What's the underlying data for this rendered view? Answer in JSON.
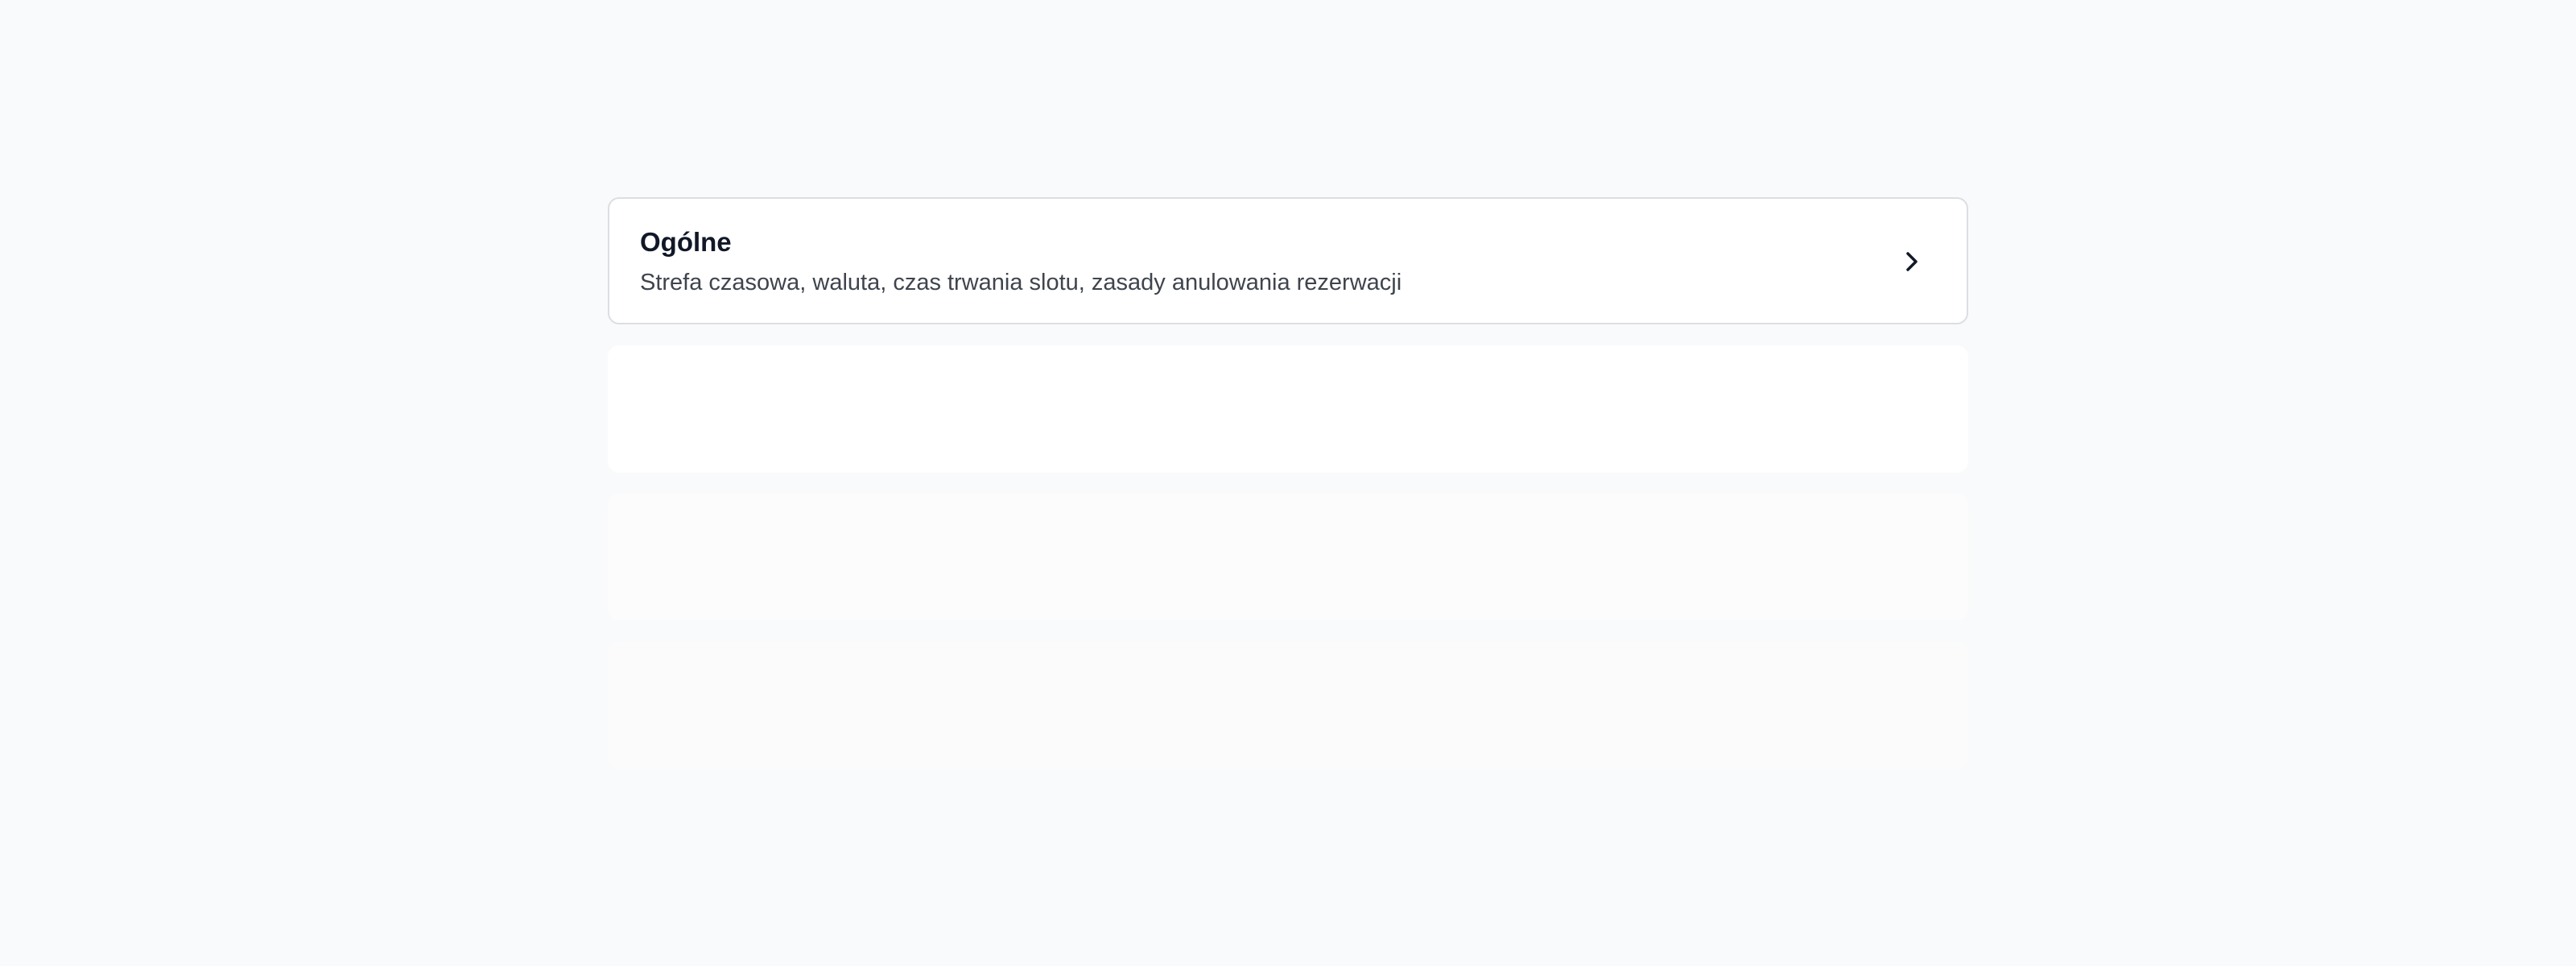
{
  "settings": {
    "general": {
      "title": "Ogólne",
      "description": "Strefa czasowa, waluta, czas trwania slotu, zasady anulowania rezerwacji",
      "icon": "chevron-right-icon"
    }
  },
  "colors": {
    "background": "#f9fafb",
    "card": "#ffffff",
    "border": "#dcdee3",
    "title": "#111827",
    "description": "#3f444d"
  }
}
